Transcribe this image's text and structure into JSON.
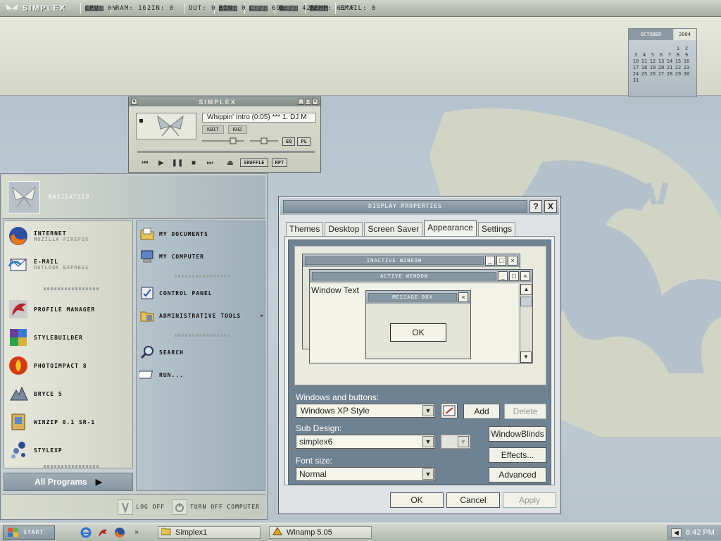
{
  "topbar": {
    "logo": "SIMPLEX",
    "meters": [
      {
        "label": "CPU: 0%",
        "bar": true
      },
      {
        "label": "RAM: 162",
        "bar": false
      },
      {
        "label": "IN: 0",
        "bar": false
      },
      {
        "label": "OUT: 0",
        "bar": false
      },
      {
        "label": "BIN: 0",
        "bar": true
      },
      {
        "label": "C:/: 69%",
        "bar": true
      },
      {
        "label": "D:/: 42%",
        "bar": true
      },
      {
        "label": "TEMP: 61°F",
        "bar": true
      },
      {
        "label": "EMAIL: 0",
        "bar": false
      }
    ]
  },
  "calendar": {
    "month": "OCTOBER",
    "year": "2004",
    "weeks": [
      [
        "",
        "",
        "",
        "",
        "",
        "1",
        "2"
      ],
      [
        "3",
        "4",
        "5",
        "6",
        "7",
        "8",
        "9"
      ],
      [
        "10",
        "11",
        "12",
        "13",
        "14",
        "15",
        "16"
      ],
      [
        "17",
        "18",
        "19",
        "20",
        "21",
        "22",
        "23"
      ],
      [
        "24",
        "25",
        "26",
        "27",
        "28",
        "29",
        "30"
      ],
      [
        "31",
        "",
        "",
        "",
        "",
        "",
        ""
      ]
    ]
  },
  "winamp": {
    "title": "SIMPLEX",
    "song": "Whippin' Intro (0:05) *** 1. DJ M",
    "khz": "KBIT",
    "hz": "KHZ",
    "eq": "EQ",
    "pl": "PL",
    "shuffle": "SHUFFLE",
    "repeat": "RPT"
  },
  "startmenu": {
    "user": "NAVIGATSIO",
    "pinned": [
      {
        "title": "INTERNET",
        "sub": "MOZILLA FIREFOX",
        "icon": "firefox-icon"
      },
      {
        "title": "E-MAIL",
        "sub": "OUTLOOK EXPRESS",
        "icon": "outlook-icon"
      }
    ],
    "recent": [
      {
        "title": "PROFILE MANAGER",
        "icon": "dragon-icon"
      },
      {
        "title": "STYLEBUILDER",
        "icon": "stylebuilder-icon"
      },
      {
        "title": "PHOTOIMPACT 8",
        "icon": "photoimpact-icon"
      },
      {
        "title": "BRYCE 5",
        "icon": "bryce-icon"
      },
      {
        "title": "WINZIP 8.1 SR-1",
        "icon": "winzip-icon"
      },
      {
        "title": "STYLEXP",
        "icon": "stylexp-icon"
      }
    ],
    "right": [
      {
        "title": "MY DOCUMENTS",
        "icon": "folder-documents-icon"
      },
      {
        "title": "MY COMPUTER",
        "icon": "computer-icon"
      },
      {
        "title": "CONTROL PANEL",
        "icon": "control-panel-icon"
      },
      {
        "title": "ADMINISTRATIVE TOOLS",
        "icon": "admin-tools-icon"
      },
      {
        "title": "SEARCH",
        "icon": "search-icon"
      },
      {
        "title": "RUN...",
        "icon": "run-icon"
      }
    ],
    "all_programs": "All Programs",
    "log_off": "LOG OFF",
    "turn_off": "TURN OFF COMPUTER"
  },
  "dialog": {
    "title": "DISPLAY PROPERTIES",
    "help": "?",
    "close": "X",
    "tabs": [
      "Themes",
      "Desktop",
      "Screen Saver",
      "Appearance",
      "Settings"
    ],
    "selected_tab": "Appearance",
    "preview": {
      "inactive": "INACTIVE WINDOW",
      "active": "ACTIVE WINDOW",
      "window_text": "Window Text",
      "message_box": "MESSAGE BOX",
      "ok": "OK"
    },
    "windows_buttons_label": "Windows and buttons:",
    "windows_buttons_value": "Windows XP Style",
    "add": "Add",
    "delete": "Delete",
    "sub_design_label": "Sub Design:",
    "sub_design_value": "simplex6",
    "windowblinds": "WindowBlinds",
    "font_size_label": "Font size:",
    "font_size_value": "Normal",
    "effects": "Effects...",
    "advanced": "Advanced",
    "ok": "OK",
    "cancel": "Cancel",
    "apply": "Apply"
  },
  "taskbar": {
    "start": "START",
    "quicklaunch": [
      "internet-explorer-icon",
      "dragon-icon",
      "firefox-icon",
      "more-icon"
    ],
    "tasks": [
      {
        "label": "Simplex1",
        "icon": "folder-icon"
      },
      {
        "label": "Winamp 5.05",
        "icon": "winamp-icon"
      }
    ],
    "clock": "6:42 PM"
  },
  "colors": {
    "accent": "#8d9ca6",
    "cream": "#e3e4d8",
    "frame": "#6f8291"
  }
}
